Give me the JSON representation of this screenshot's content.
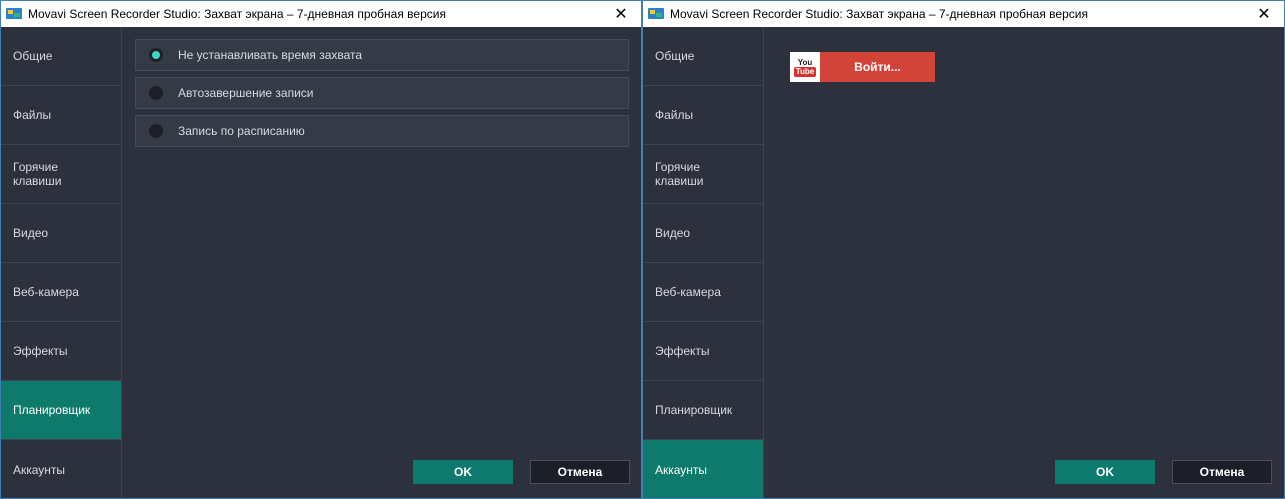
{
  "window_title": "Movavi Screen Recorder Studio: Захват экрана – 7-дневная пробная версия",
  "close_glyph": "✕",
  "nav": [
    {
      "label": "Общие"
    },
    {
      "label": "Файлы"
    },
    {
      "label": "Горячие клавиши"
    },
    {
      "label": "Видео"
    },
    {
      "label": "Веб-камера"
    },
    {
      "label": "Эффекты"
    },
    {
      "label": "Планировщик"
    },
    {
      "label": "Аккаунты"
    }
  ],
  "left_window": {
    "active_nav": "Планировщик",
    "options": [
      {
        "label": "Не устанавливать время захвата",
        "checked": true
      },
      {
        "label": "Автозавершение записи",
        "checked": false
      },
      {
        "label": "Запись по расписанию",
        "checked": false
      }
    ]
  },
  "right_window": {
    "active_nav": "Аккаунты",
    "youtube": {
      "logo_top": "You",
      "logo_bottom": "Tube",
      "label": "Войти..."
    }
  },
  "buttons": {
    "ok": "OK",
    "cancel": "Отмена"
  },
  "colors": {
    "accent": "#0e7a6b",
    "youtube_red": "#d2433a",
    "radio_checked": "#3fd6c2",
    "background": "#2c313d"
  },
  "icons": {
    "app": "movavi-app-icon",
    "close": "close-icon",
    "youtube": "youtube-logo-icon"
  }
}
